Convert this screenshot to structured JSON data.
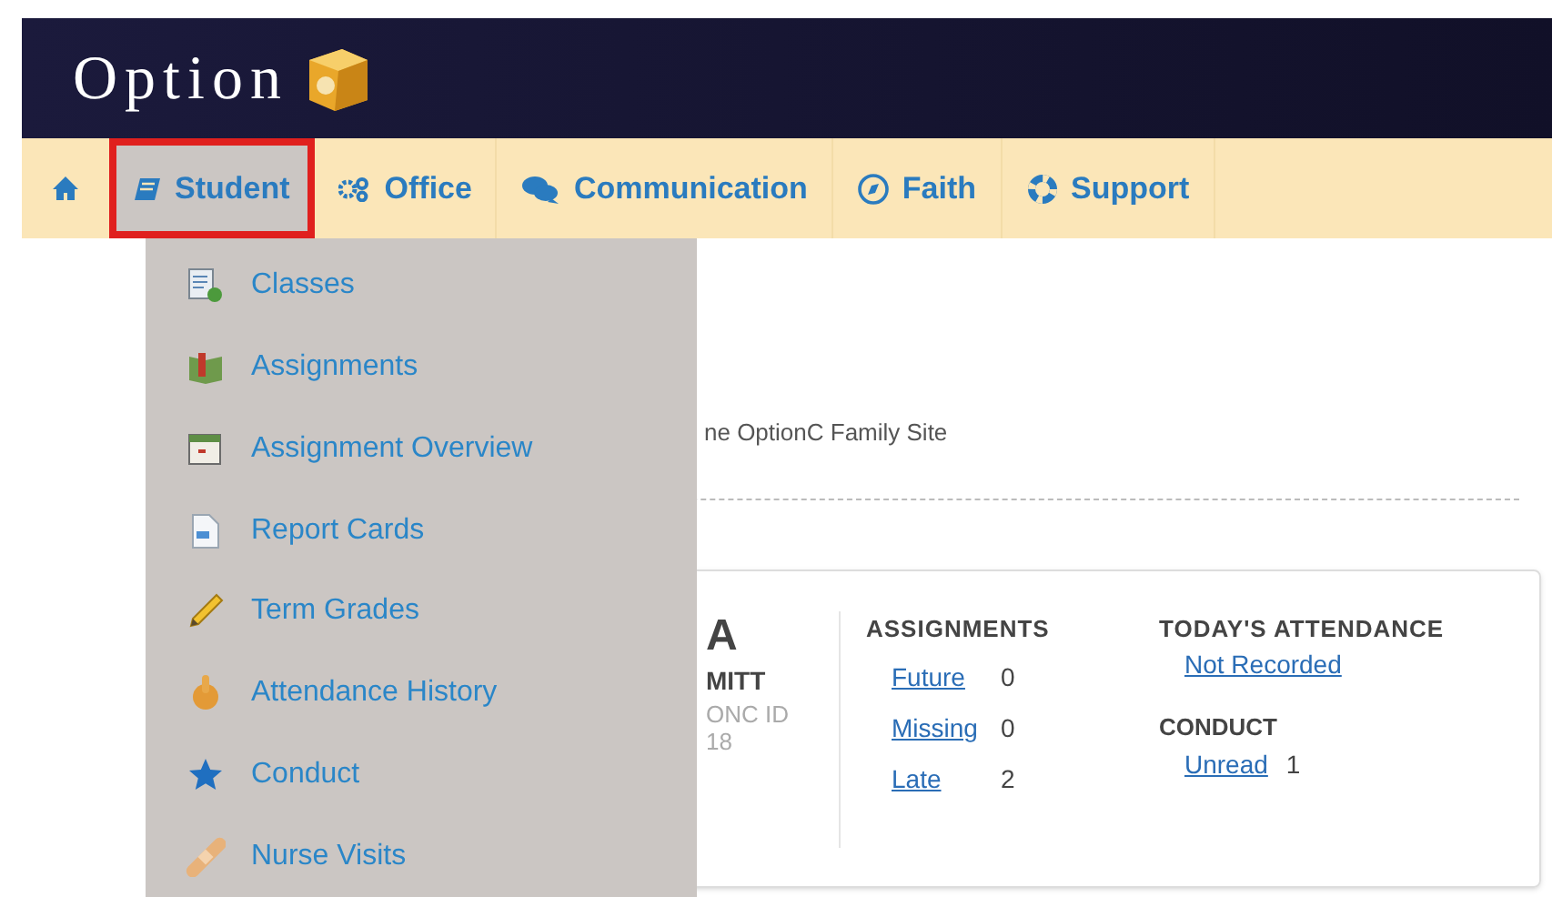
{
  "header": {
    "logo_text": "Option"
  },
  "nav": [
    {
      "label": "Student",
      "selected": true
    },
    {
      "label": "Office",
      "selected": false
    },
    {
      "label": "Communication",
      "selected": false
    },
    {
      "label": "Faith",
      "selected": false
    },
    {
      "label": "Support",
      "selected": false
    }
  ],
  "student_menu": [
    {
      "label": "Classes"
    },
    {
      "label": "Assignments"
    },
    {
      "label": "Assignment Overview"
    },
    {
      "label": "Report Cards"
    },
    {
      "label": "Term Grades"
    },
    {
      "label": "Attendance History"
    },
    {
      "label": "Conduct"
    },
    {
      "label": "Nurse Visits"
    }
  ],
  "welcome_text": "ne OptionC Family Site",
  "student_card": {
    "name_line_1": "A",
    "name_line_2": "MITT",
    "id_label": "ONC ID",
    "id_value": "18",
    "assignments": {
      "title": "ASSIGNMENTS",
      "rows": [
        {
          "label": "Future",
          "count": "0"
        },
        {
          "label": "Missing",
          "count": "0"
        },
        {
          "label": "Late",
          "count": "2"
        }
      ]
    },
    "attendance": {
      "title": "TODAY'S ATTENDANCE",
      "status": "Not Recorded"
    },
    "conduct": {
      "title": "CONDUCT",
      "label": "Unread",
      "count": "1"
    }
  }
}
